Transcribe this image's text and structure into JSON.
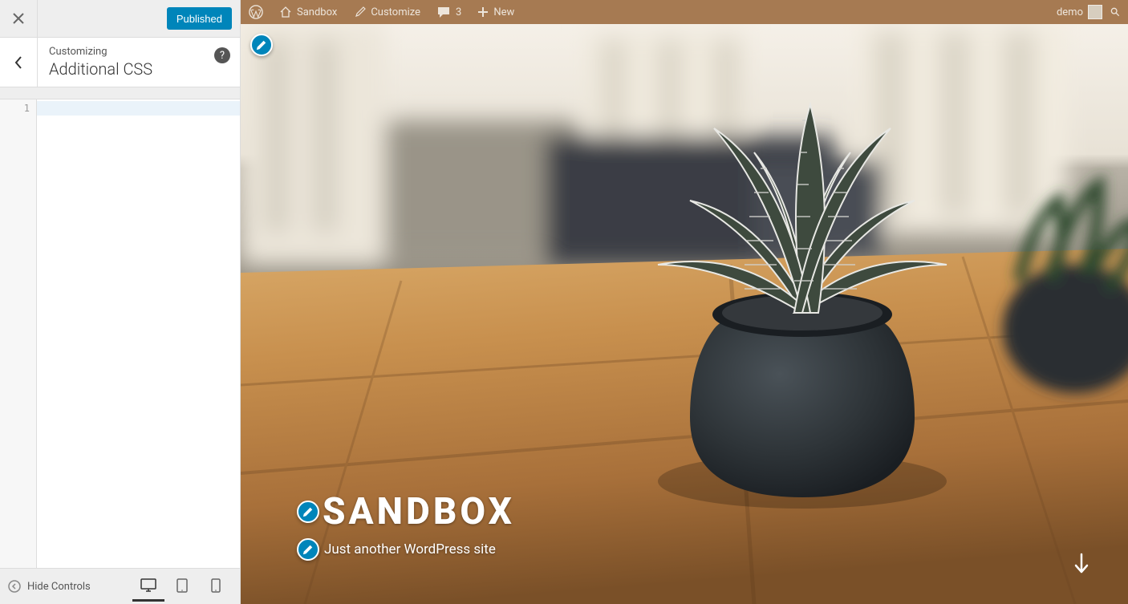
{
  "customizer": {
    "publish_label": "Published",
    "customizing_label": "Customizing",
    "section_title": "Additional CSS",
    "editor_line": "1",
    "editor_value": "",
    "hide_controls_label": "Hide Controls"
  },
  "adminbar": {
    "site_name": "Sandbox",
    "customize_label": "Customize",
    "comment_count": "3",
    "new_label": "New",
    "user_name": "demo"
  },
  "hero": {
    "title": "SANDBOX",
    "tagline": "Just another WordPress site"
  },
  "colors": {
    "accent": "#0085ba",
    "adminbar": "#a67a52"
  }
}
